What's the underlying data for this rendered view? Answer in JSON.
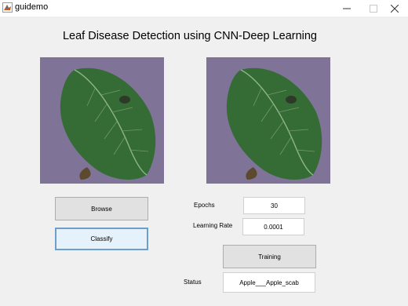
{
  "window": {
    "title": "guidemo"
  },
  "main": {
    "heading": "Leaf Disease Detection using CNN-Deep Learning"
  },
  "images": {
    "input_image_icon": "leaf-photo",
    "processed_image_icon": "leaf-photo"
  },
  "controls": {
    "browse_label": "Browse",
    "classify_label": "Classify",
    "epochs_label": "Epochs",
    "epochs_value": "30",
    "learning_rate_label": "Learning Rate",
    "learning_rate_value": "0.0001",
    "training_label": "Training",
    "status_label": "Status",
    "status_value": "Apple___Apple_scab"
  },
  "colors": {
    "leaf_green": "#356b35",
    "background_purple": "#7a6e93",
    "focus_border": "#6f9fc7"
  }
}
